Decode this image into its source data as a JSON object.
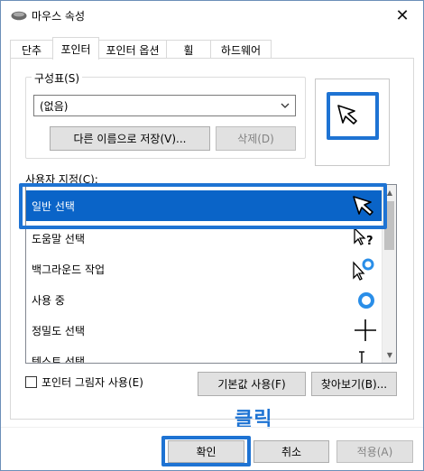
{
  "window": {
    "title": "마우스 속성",
    "close_glyph": "✕"
  },
  "tabs": [
    {
      "label": "단추"
    },
    {
      "label": "포인터"
    },
    {
      "label": "포인터 옵션"
    },
    {
      "label": "휠"
    },
    {
      "label": "하드웨어"
    }
  ],
  "scheme": {
    "label": "구성표(S)",
    "selected": "(없음)",
    "save_label": "다른 이름으로 저장(V)...",
    "delete_label": "삭제(D)"
  },
  "customize": {
    "label": "사용자 지정(C):",
    "items": [
      {
        "label": "일반 선택",
        "icon": "arrow-cursor-icon"
      },
      {
        "label": "도움말 선택",
        "icon": "help-cursor-icon"
      },
      {
        "label": "백그라운드 작업",
        "icon": "working-in-background-cursor-icon"
      },
      {
        "label": "사용 중",
        "icon": "busy-cursor-icon"
      },
      {
        "label": "정밀도 선택",
        "icon": "precision-cursor-icon"
      },
      {
        "label": "텍스트 선택",
        "icon": "text-cursor-icon"
      }
    ]
  },
  "shadow": {
    "label": "포인터 그림자 사용(E)"
  },
  "buttons": {
    "default_label": "기본값 사용(F)",
    "browse_label": "찾아보기(B)...",
    "ok_label": "확인",
    "cancel_label": "취소",
    "apply_label": "적용(A)"
  },
  "annotation": {
    "text": "클릭",
    "color": "#1e73d3"
  },
  "colors": {
    "selection": "#0a64c8",
    "highlight_frame": "#1e73d3"
  }
}
